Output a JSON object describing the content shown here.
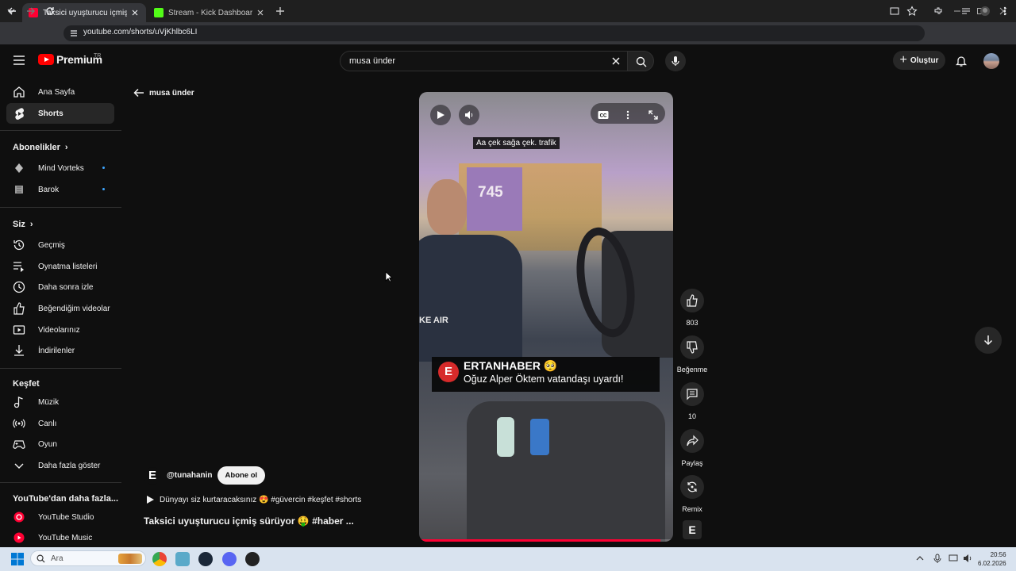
{
  "browser": {
    "tabs": [
      {
        "title": "Taksici uyuşturucu içmiş sürüyor",
        "active": true,
        "favicon_color": "#ff0033"
      },
      {
        "title": "Stream - Kick Dashboard",
        "active": false,
        "favicon_color": "#53fc18"
      }
    ],
    "url": "youtube.com/shorts/uVjKhlbc6LI"
  },
  "header": {
    "logo_text": "Premium",
    "logo_region": "TR",
    "search_value": "musa ünder",
    "create_label": "Oluştur"
  },
  "sidebar": {
    "main": [
      {
        "label": "Ana Sayfa",
        "icon": "home-icon"
      },
      {
        "label": "Shorts",
        "icon": "shorts-icon",
        "active": true
      }
    ],
    "subscriptions_title": "Abonelikler",
    "subscriptions": [
      {
        "label": "Mind Vorteks",
        "icon": "channel-icon"
      },
      {
        "label": "Barok",
        "icon": "channel-icon"
      }
    ],
    "you_title": "Siz",
    "you": [
      {
        "label": "Geçmiş",
        "icon": "history-icon"
      },
      {
        "label": "Oynatma listeleri",
        "icon": "playlist-icon"
      },
      {
        "label": "Daha sonra izle",
        "icon": "clock-icon"
      },
      {
        "label": "Beğendiğim videolar",
        "icon": "like-icon"
      },
      {
        "label": "Videolarınız",
        "icon": "video-icon"
      },
      {
        "label": "İndirilenler",
        "icon": "download-icon"
      }
    ],
    "explore_title": "Keşfet",
    "explore": [
      {
        "label": "Müzik",
        "icon": "music-icon"
      },
      {
        "label": "Canlı",
        "icon": "live-icon"
      },
      {
        "label": "Oyun",
        "icon": "gaming-icon"
      },
      {
        "label": "Daha fazla göster",
        "icon": "chevron-down-icon"
      }
    ],
    "more_title": "YouTube'dan daha fazla...",
    "more": [
      {
        "label": "YouTube Studio",
        "icon": "studio-icon"
      },
      {
        "label": "YouTube Music",
        "icon": "yt-music-icon"
      }
    ]
  },
  "main": {
    "back_label": "musa ünder"
  },
  "video": {
    "caption": "Aa çek sağa çek. trafik",
    "plate_text": "745",
    "shirt_text": "KE AIR",
    "lower_third_badge": "E",
    "lower_third_brand": "ERTANHABER 🥺",
    "lower_third_line": "Oğuz Alper Öktem vatandaşı uyardı!",
    "progress": 0.95
  },
  "actions": {
    "like_count": "803",
    "dislike_label": "Beğenme",
    "comment_count": "10",
    "share_label": "Paylaş",
    "remix_label": "Remix"
  },
  "short_info": {
    "channel_logo": "E",
    "channel_name": "@tunahanin",
    "subscribe_label": "Abone ol",
    "description": "Dünyayı siz kurtaracaksınız 😍 #güvercin #keşfet #shorts",
    "title": "Taksici uyuşturucu içmiş sürüyor 🤑 #haber ..."
  },
  "taskbar": {
    "search_placeholder": "Ara",
    "time": "20:56",
    "date": "6.02.2026"
  }
}
